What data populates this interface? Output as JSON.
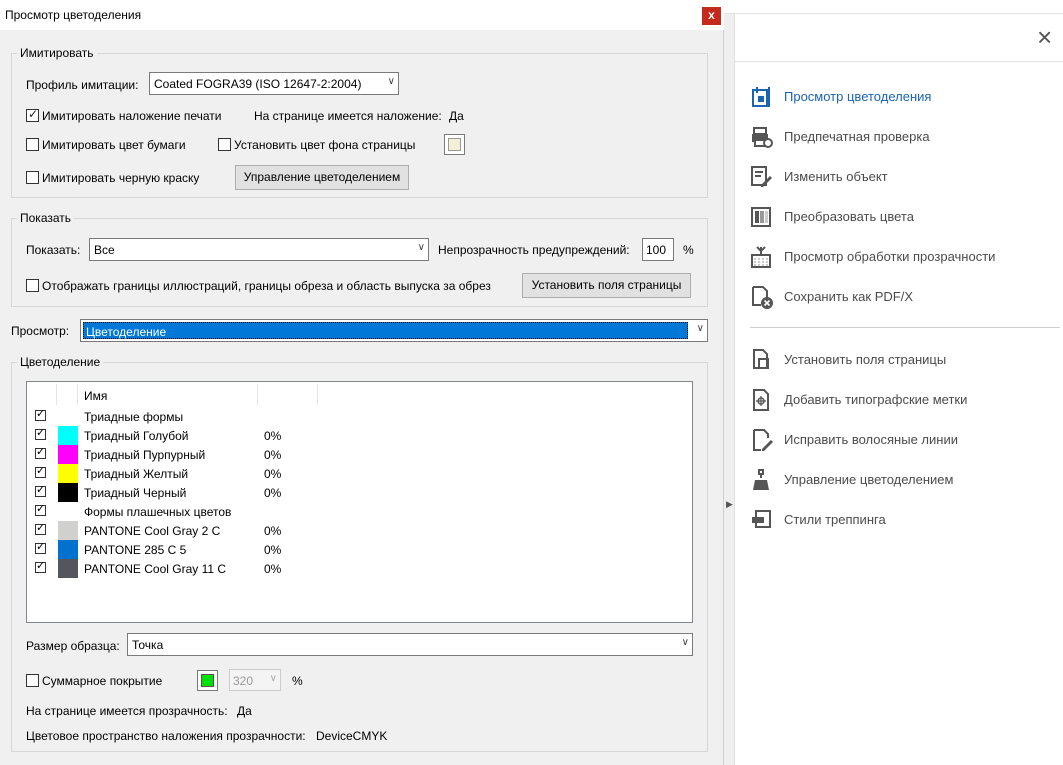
{
  "dialog": {
    "title": "Просмотр цветоделения",
    "close_label": "x",
    "simulate": {
      "legend": "Имитировать",
      "profile_label": "Профиль имитации:",
      "profile_value": "Coated FOGRA39 (ISO 12647-2:2004)",
      "overprint_label": "Имитировать наложение печати",
      "page_has_overprint_label": "На странице имеется наложение:",
      "page_has_overprint_value": "Да",
      "paper_color_label": "Имитировать цвет бумаги",
      "page_bg_label": "Установить цвет фона страницы",
      "black_ink_label": "Имитировать черную краску",
      "ink_manager_button": "Управление цветоделением"
    },
    "show": {
      "legend": "Показать",
      "show_label": "Показать:",
      "show_value": "Все",
      "warning_opacity_label": "Непрозрачность предупреждений:",
      "warning_opacity_value": "100",
      "percent": "%",
      "show_boxes_label": "Отображать границы иллюстраций, границы обреза и область выпуска за обрез",
      "page_boxes_button": "Установить поля страницы"
    },
    "preview": {
      "label": "Просмотр:",
      "value": "Цветоделение"
    },
    "separations": {
      "legend": "Цветоделение",
      "name_header": "Имя",
      "rows": [
        {
          "name": "Триадные формы",
          "pct": "",
          "color": ""
        },
        {
          "name": "Триадный Голубой",
          "pct": "0%",
          "color": "#00ffff"
        },
        {
          "name": "Триадный Пурпурный",
          "pct": "0%",
          "color": "#ff00ff"
        },
        {
          "name": "Триадный Желтый",
          "pct": "0%",
          "color": "#ffff00"
        },
        {
          "name": "Триадный Черный",
          "pct": "0%",
          "color": "#000000"
        },
        {
          "name": "Формы плашечных цветов",
          "pct": "",
          "color": ""
        },
        {
          "name": "PANTONE Cool Gray 2 C",
          "pct": "0%",
          "color": "#d0d0ce"
        },
        {
          "name": "PANTONE 285 C 5",
          "pct": "0%",
          "color": "#0072ce"
        },
        {
          "name": "PANTONE Cool Gray 11 C",
          "pct": "0%",
          "color": "#53565a"
        }
      ]
    },
    "sample_size": {
      "label": "Размер образца:",
      "value": "Точка"
    },
    "total_coverage": {
      "label": "Суммарное покрытие",
      "color": "#00e000",
      "value": "320",
      "percent": "%"
    },
    "transparency": {
      "label": "На странице имеется прозрачность:",
      "value": "Да"
    },
    "blend_space": {
      "label": "Цветовое пространство наложения прозрачности:",
      "value": "DeviceCMYK"
    }
  },
  "right_panel": {
    "close_label": "×",
    "tools_top": [
      {
        "label": "Просмотр цветоделения",
        "icon": "separation-preview-icon",
        "active": true
      },
      {
        "label": "Предпечатная проверка",
        "icon": "preflight-icon",
        "active": false
      },
      {
        "label": "Изменить объект",
        "icon": "edit-object-icon",
        "active": false
      },
      {
        "label": "Преобразовать цвета",
        "icon": "convert-colors-icon",
        "active": false
      },
      {
        "label": "Просмотр обработки прозрачности",
        "icon": "flattener-preview-icon",
        "active": false
      },
      {
        "label": "Сохранить как PDF/X",
        "icon": "save-pdfx-icon",
        "active": false
      }
    ],
    "tools_bottom": [
      {
        "label": "Установить поля страницы",
        "icon": "page-boxes-icon"
      },
      {
        "label": "Добавить типографские метки",
        "icon": "printer-marks-icon"
      },
      {
        "label": "Исправить волосяные линии",
        "icon": "fix-hairlines-icon"
      },
      {
        "label": "Управление цветоделением",
        "icon": "ink-manager-icon"
      },
      {
        "label": "Стили треппинга",
        "icon": "trap-presets-icon"
      }
    ],
    "accent_color": "#1a63b5"
  }
}
